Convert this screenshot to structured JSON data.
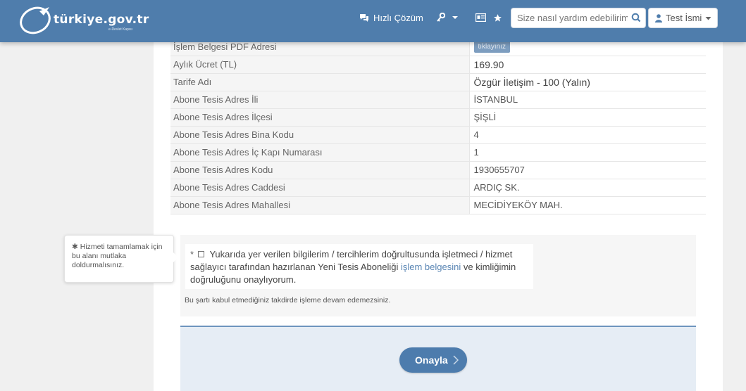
{
  "header": {
    "logo_text": "türkiye.gov.tr",
    "logo_subtext": "e-Devlet Kapısı",
    "quick_solution": "Hızlı Çözüm",
    "search_placeholder": "Size nasıl yardım edebilirim?",
    "user_name": "Test İsmi"
  },
  "table": {
    "rows": [
      {
        "key": "İşlem Belgesi PDF Adresi",
        "value": "tıklayınız",
        "type": "button"
      },
      {
        "key": "Aylık Ücret (TL)",
        "value": "169.90",
        "type": "big"
      },
      {
        "key": "Tarife Adı",
        "value": "Özgür İletişim - 100 (Yalın)",
        "type": "big"
      },
      {
        "key": "Abone Tesis Adres İli",
        "value": "İSTANBUL"
      },
      {
        "key": "Abone Tesis Adres İlçesi",
        "value": "ŞİŞLİ"
      },
      {
        "key": "Abone Tesis Adres Bina Kodu",
        "value": "4"
      },
      {
        "key": "Abone Tesis Adres İç Kapı Numarası",
        "value": "1"
      },
      {
        "key": "Abone Tesis Adres Kodu",
        "value": "1930655707"
      },
      {
        "key": "Abone Tesis Adres Caddesi",
        "value": "ARDIÇ SK."
      },
      {
        "key": "Abone Tesis Adres Mahallesi",
        "value": "MECİDİYEKÖY MAH."
      }
    ]
  },
  "tooltip": {
    "star": "✱",
    "text": "Hizmeti tamamlamak için bu alanı mutlaka doldurmalısınız."
  },
  "consent": {
    "required_mark": "*",
    "text_before": "Yukarıda yer verilen bilgilerim / tercihlerim doğrultusunda işletmeci / hizmet sağlayıcı tarafından hazırlanan Yeni Tesis Aboneliği",
    "link_text": "işlem belgesini",
    "text_after": "ve kimliğimin doğruluğunu onaylıyorum.",
    "warning": "Bu şartı kabul etmediğiniz takdirde işleme devam edemezsiniz."
  },
  "approve_button": "Onayla",
  "colors": {
    "header": "#4f7dac",
    "button": "#4d7cad",
    "link": "#5a86b4"
  }
}
